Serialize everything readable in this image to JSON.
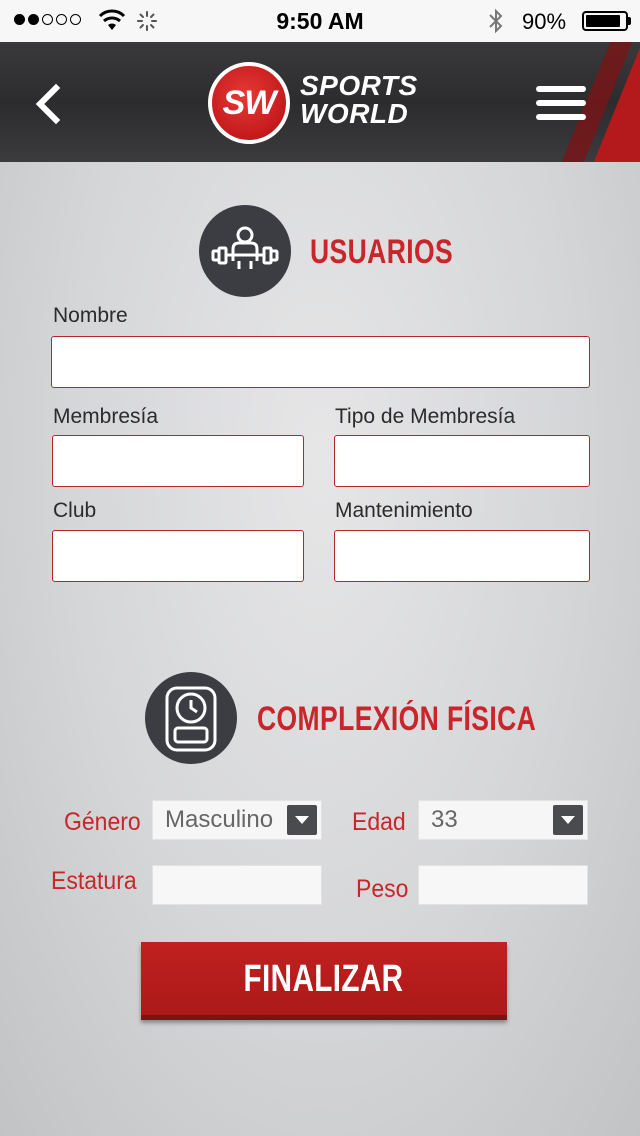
{
  "status_bar": {
    "time": "9:50 AM",
    "battery_percent": "90%",
    "battery_level": 0.9,
    "signal_bars_filled": 2,
    "signal_bars_total": 5
  },
  "header": {
    "logo_initials": "SW",
    "logo_line1": "SPORTS",
    "logo_line2": "WORLD",
    "back_icon": "chevron-left-icon",
    "menu_icon": "hamburger-menu-icon"
  },
  "usuarios": {
    "title": "USUARIOS",
    "icon": "weightlifter-icon",
    "fields": {
      "nombre_label": "Nombre",
      "nombre_value": "",
      "membresia_label": "Membresía",
      "membresia_value": "",
      "tipo_membresia_label": "Tipo de Membresía",
      "tipo_membresia_value": "",
      "club_label": "Club",
      "club_value": "",
      "mantenimiento_label": "Mantenimiento",
      "mantenimiento_value": ""
    }
  },
  "complexion": {
    "title": "COMPLEXIÓN FÍSICA",
    "icon": "scale-icon",
    "genero_label": "Género",
    "genero_value": "Masculino",
    "edad_label": "Edad",
    "edad_value": "33",
    "estatura_label": "Estatura",
    "estatura_value": "",
    "peso_label": "Peso",
    "peso_value": ""
  },
  "actions": {
    "finalize_label": "FINALIZAR"
  },
  "colors": {
    "accent_red": "#c8262a",
    "header_dark": "#2f2f31",
    "icon_circle": "#3b3d42"
  }
}
